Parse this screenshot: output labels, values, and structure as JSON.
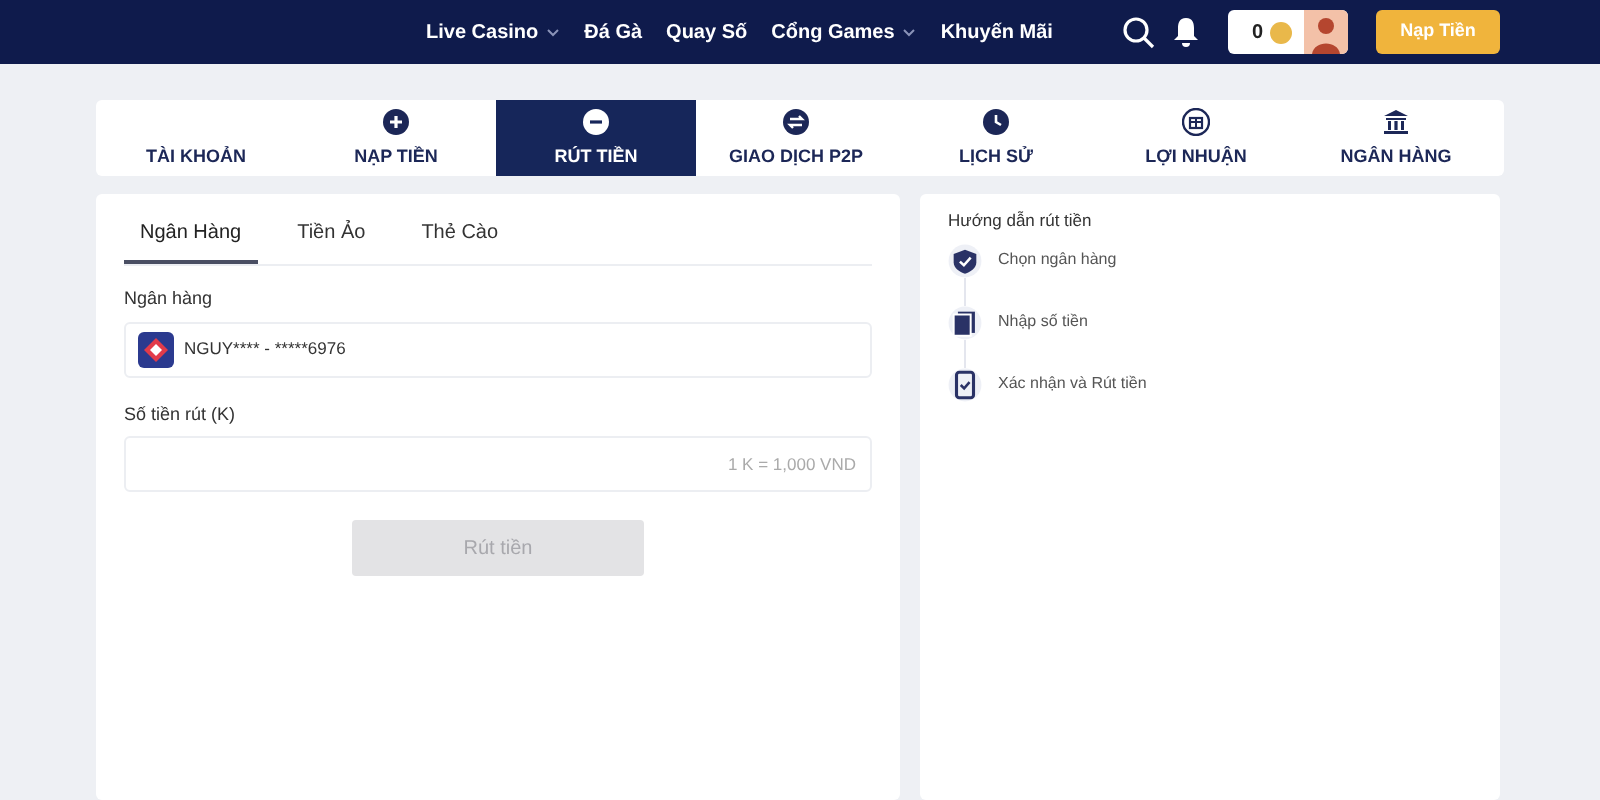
{
  "nav": {
    "items": [
      {
        "label": "Live Casino",
        "dropdown": true
      },
      {
        "label": "Đá Gà",
        "dropdown": false
      },
      {
        "label": "Quay Số",
        "dropdown": false
      },
      {
        "label": "Cổng Games",
        "dropdown": true
      },
      {
        "label": "Khuyến Mãi",
        "dropdown": false
      }
    ],
    "balance": "0",
    "deposit_button": "Nạp Tiền"
  },
  "tabs": [
    {
      "label": "TÀI KHOẢN",
      "selected": false
    },
    {
      "label": "NẠP TIỀN",
      "selected": false
    },
    {
      "label": "RÚT TIỀN",
      "selected": true
    },
    {
      "label": "GIAO DỊCH P2P",
      "selected": false
    },
    {
      "label": "LỊCH SỬ",
      "selected": false
    },
    {
      "label": "LỢI NHUẬN",
      "selected": false
    },
    {
      "label": "NGÂN HÀNG",
      "selected": false
    }
  ],
  "withdraw": {
    "subtabs": [
      {
        "label": "Ngân Hàng",
        "selected": true
      },
      {
        "label": "Tiền Ảo",
        "selected": false
      },
      {
        "label": "Thẻ Cào",
        "selected": false
      }
    ],
    "bank_label": "Ngân hàng",
    "bank_value": "NGUY**** - *****6976",
    "amount_label": "Số tiền rút (K)",
    "amount_placeholder": "1 K = 1,000 VND",
    "submit": {
      "label": "Rút tiền",
      "disabled": true
    }
  },
  "guide": {
    "title": "Hướng dẫn rút tiền",
    "steps": [
      "Chọn ngân hàng",
      "Nhập số tiền",
      "Xác nhận và Rút tiền"
    ]
  }
}
